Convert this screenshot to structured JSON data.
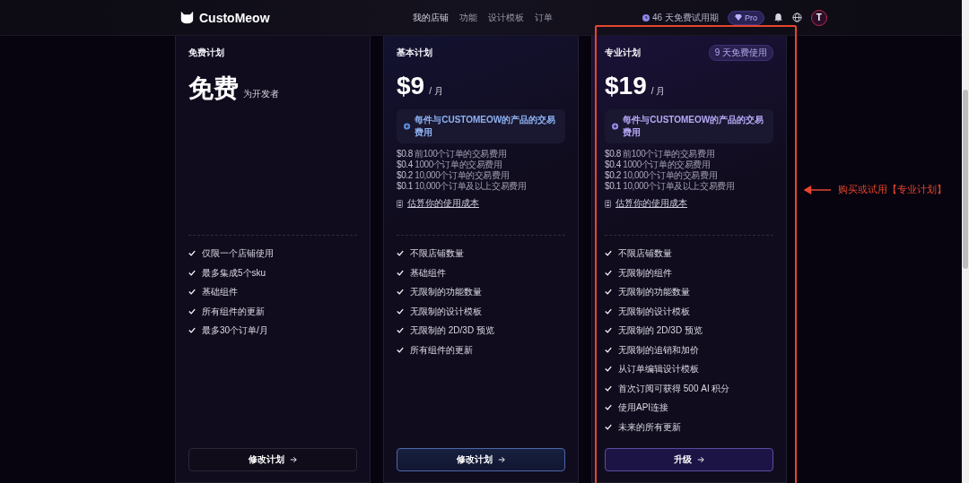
{
  "header": {
    "brand": "CustoMeow",
    "nav": [
      {
        "label": "我的店铺",
        "selected": true
      },
      {
        "label": "功能",
        "selected": false
      },
      {
        "label": "设计模板",
        "selected": false
      },
      {
        "label": "订单",
        "selected": false
      }
    ],
    "trial": "46 天免费试用期",
    "plan_badge": "Pro",
    "avatar": "T"
  },
  "plans": [
    {
      "kind": "free",
      "title": "免费计划",
      "price": "免费",
      "unit": "为开发者",
      "features": [
        "仅限一个店铺使用",
        "最多集成5个sku",
        "基础组件",
        "所有组件的更新",
        "最多30个订单/月"
      ],
      "button": "修改计划"
    },
    {
      "kind": "basic",
      "title": "基本计划",
      "price": "$9",
      "unit": "/ 月",
      "fee_note": "每件与CUSTOMEOW的产品的交易费用",
      "tiers": [
        {
          "amount": "$0.8",
          "text": "前100个订单的交易费用"
        },
        {
          "amount": "$0.4",
          "text": "1000个订单的交易费用"
        },
        {
          "amount": "$0.2",
          "text": "10,000个订单的交易费用"
        },
        {
          "amount": "$0.1",
          "text": "10,000个订单及以上交易费用"
        }
      ],
      "estimate_link": "估算你的使用成本",
      "features": [
        "不限店铺数量",
        "基础组件",
        "无限制的功能数量",
        "无限制的设计模板",
        "无限制的 2D/3D 预览",
        "所有组件的更新"
      ],
      "button": "修改计划"
    },
    {
      "kind": "pro",
      "title": "专业计划",
      "badge": "9 天免费使用",
      "price": "$19",
      "unit": "/ 月",
      "fee_note": "每件与CUSTOMEOW的产品的交易费用",
      "tiers": [
        {
          "amount": "$0.8",
          "text": "前100个订单的交易费用"
        },
        {
          "amount": "$0.4",
          "text": "1000个订单的交易费用"
        },
        {
          "amount": "$0.2",
          "text": "10,000个订单的交易费用"
        },
        {
          "amount": "$0.1",
          "text": "10,000个订单及以上交易费用"
        }
      ],
      "estimate_link": "估算你的使用成本",
      "features": [
        "不限店铺数量",
        "无限制的组件",
        "无限制的功能数量",
        "无限制的设计模板",
        "无限制的 2D/3D 预览",
        "无限制的追销和加价",
        "从订单编辑设计模板",
        "首次订阅可获得 500 AI 积分",
        "使用API连接",
        "未来的所有更新"
      ],
      "button": "升级",
      "highlighted": true
    }
  ],
  "annotation": {
    "text": "购买或试用【专业计划】"
  }
}
